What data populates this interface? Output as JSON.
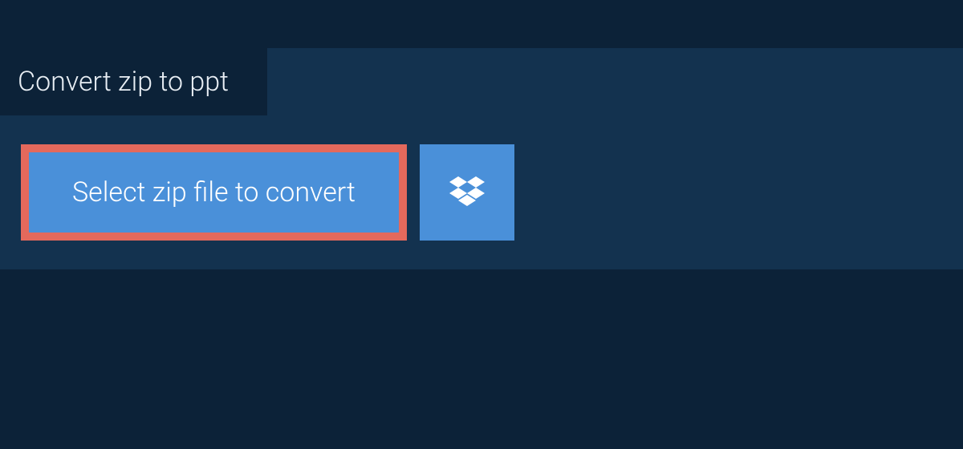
{
  "tab": {
    "label": "Convert zip to ppt"
  },
  "actions": {
    "select_file_label": "Select zip file to convert"
  },
  "colors": {
    "bg_dark": "#0c2238",
    "bg_panel": "#13324f",
    "button_blue": "#4a90d9",
    "highlight_border": "#e4695c",
    "text_light": "#e8eef4"
  }
}
